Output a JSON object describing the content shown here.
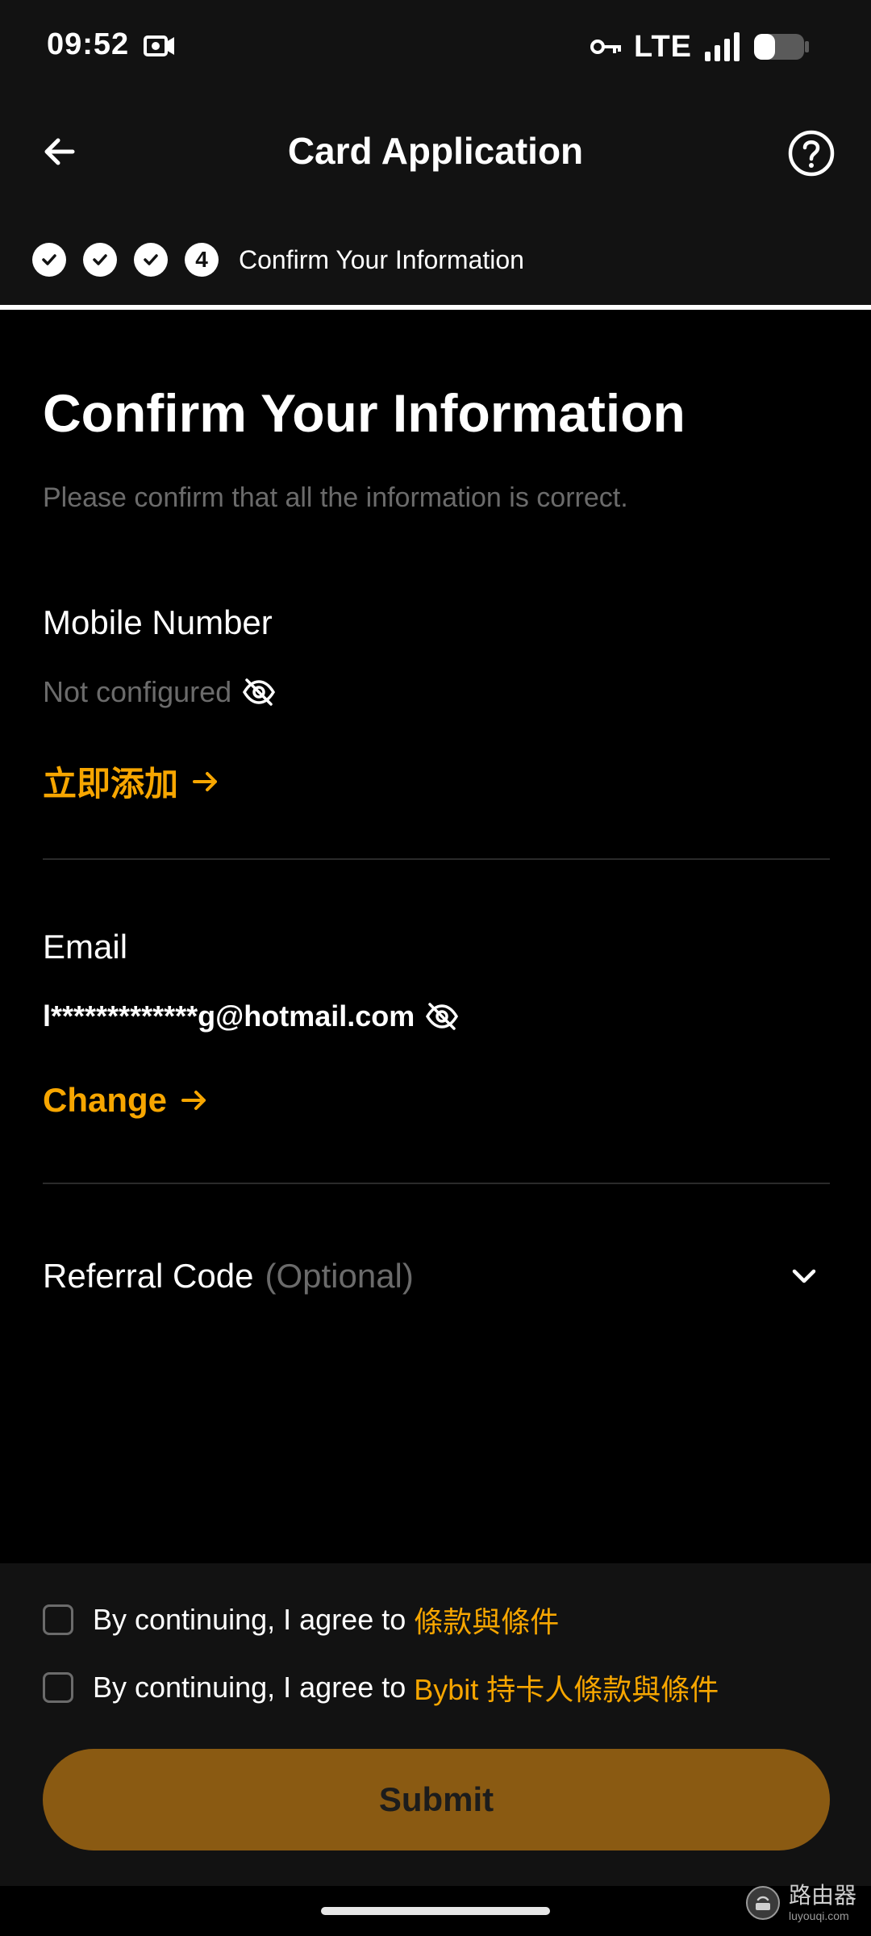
{
  "status_bar": {
    "time": "09:52",
    "network": "LTE",
    "notification_icon": "photo-notification-icon",
    "icons": [
      "vpn-key-icon",
      "signal-icon",
      "battery-icon"
    ]
  },
  "header": {
    "title": "Card Application",
    "back_icon": "arrow-left-icon",
    "help_icon": "help-circle-icon"
  },
  "stepper": {
    "completed_steps": 3,
    "current_step_number": "4",
    "current_step_label": "Confirm Your Information"
  },
  "main": {
    "title": "Confirm Your Information",
    "subtitle": "Please confirm that all the information is correct.",
    "mobile": {
      "label": "Mobile Number",
      "value": "Not configured",
      "action": "立即添加"
    },
    "email": {
      "label": "Email",
      "value": "l*************g@hotmail.com",
      "action": "Change"
    },
    "referral": {
      "label": "Referral Code",
      "optional": "(Optional)"
    }
  },
  "agreements": [
    {
      "prefix": "By continuing, I agree to",
      "link": "條款與條件"
    },
    {
      "prefix": "By continuing, I agree to",
      "link": "Bybit 持卡人條款與條件"
    }
  ],
  "submit_label": "Submit",
  "watermark": {
    "text": "路由器",
    "url": "luyouqi.com"
  },
  "colors": {
    "accent": "#f7a600",
    "submit_bg": "#8a5a12",
    "muted": "#6b6b6b",
    "panel": "#121212"
  }
}
